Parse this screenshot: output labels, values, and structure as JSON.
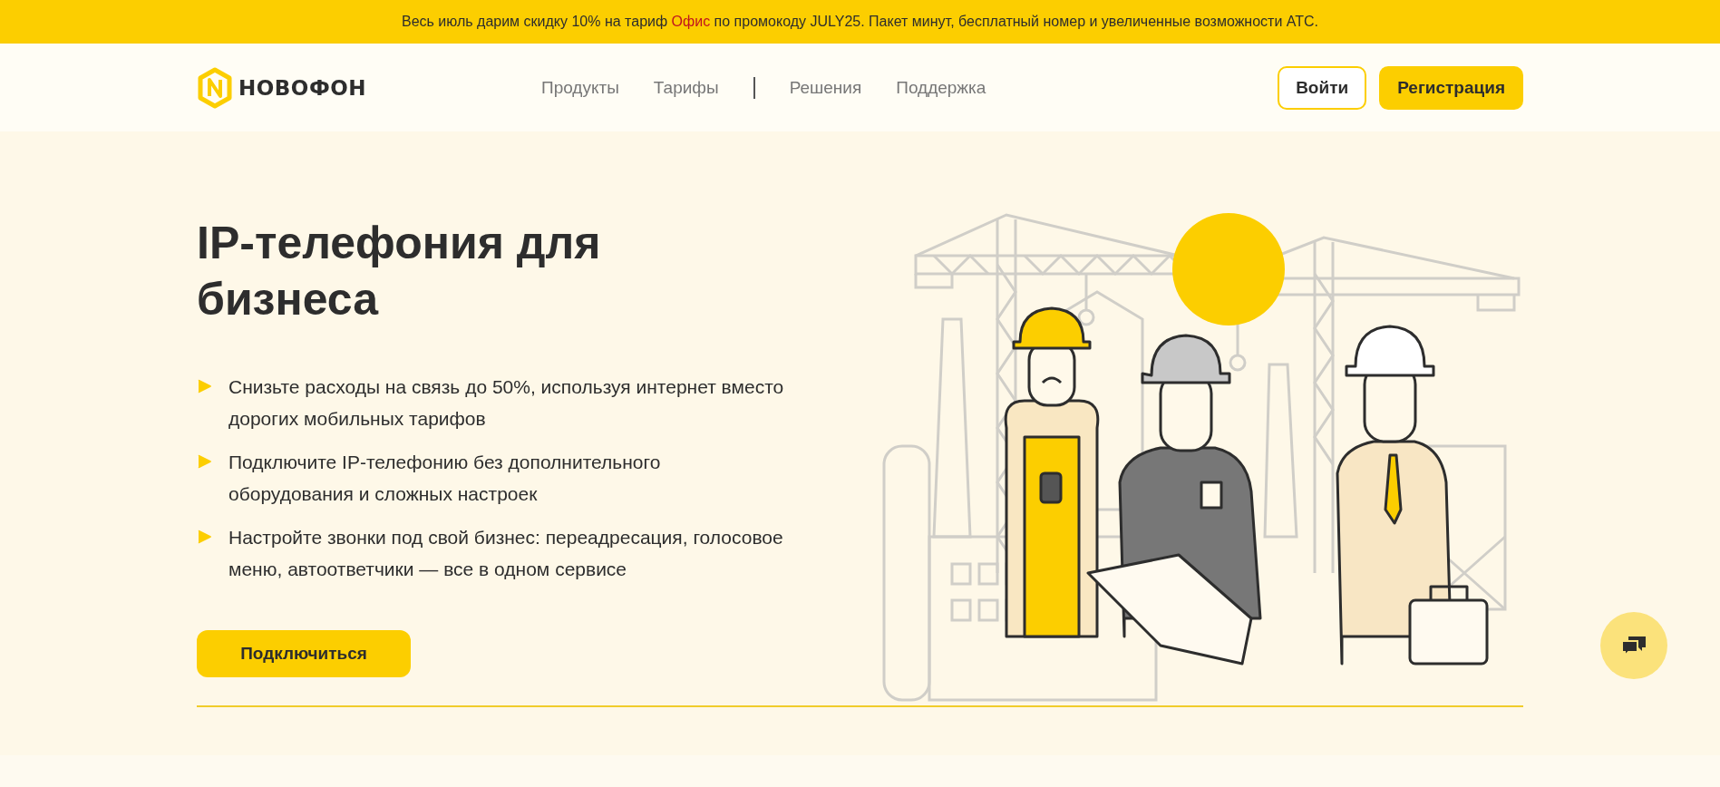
{
  "promo_banner": {
    "text_before": "Весь июль дарим скидку 10% на тариф",
    "link": "Офис",
    "text_after": "по промокоду JULY25. Пакет минут, бесплатный номер и увеличенные возможности АТС."
  },
  "header": {
    "logo": "НОВОФОН",
    "nav": [
      {
        "label": "Продукты",
        "kind": "link"
      },
      {
        "label": "Тарифы",
        "kind": "link"
      },
      {
        "kind": "divider"
      },
      {
        "label": "Решения",
        "kind": "link"
      },
      {
        "label": "Поддержка",
        "kind": "link"
      }
    ],
    "login_button": "Войти",
    "register_button": "Регистрация"
  },
  "hero": {
    "title": "IP-телефония для бизнеса",
    "bullets": [
      "Снизьте расходы на связь до 50%, используя интернет вместо дорогих мобильных тарифов",
      "Подключите IP-телефонию без дополнительного оборудования и сложных настроек",
      "Настройте звонки под свой бизнес: переадресация, голосовое меню, автоответчики — все в одном сервисе"
    ],
    "cta_button": "Подключиться"
  }
}
